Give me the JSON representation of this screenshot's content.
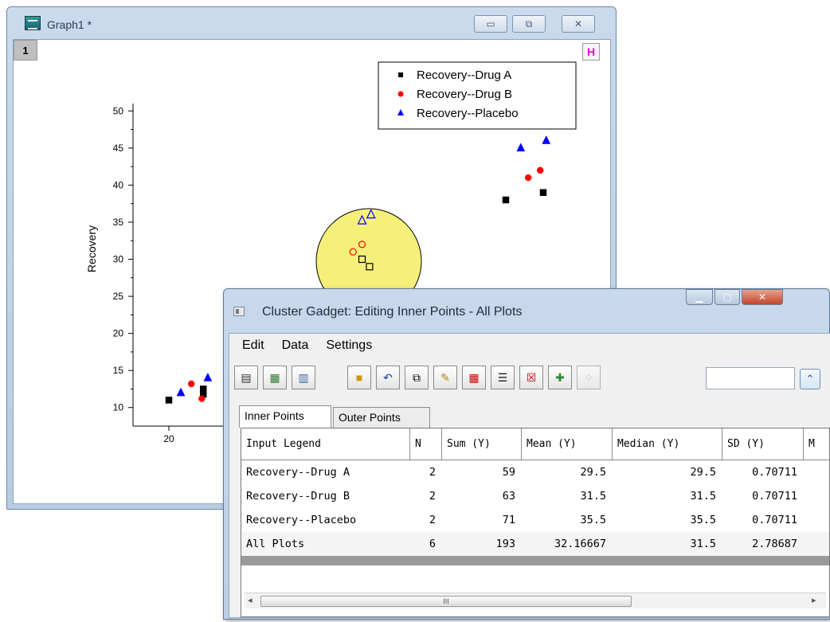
{
  "graph_window": {
    "title": "Graph1 *",
    "layer_label": "1",
    "h_button_label": "H",
    "minimize_glyph": "▭",
    "restore_glyph": "⧉",
    "close_glyph": "✕"
  },
  "chart_data": {
    "type": "scatter",
    "ylabel": "Recovery",
    "xlabel": "",
    "y_ticks": [
      "10",
      "15",
      "20",
      "25",
      "30",
      "35",
      "40",
      "45",
      "50"
    ],
    "x_ticks": [
      "20"
    ],
    "ylim": [
      7.5,
      51
    ],
    "legend_position": "top-right",
    "series": [
      {
        "name": "Recovery--Drug A",
        "color": "#000000",
        "marker": "square",
        "points": [
          [
            20,
            11
          ],
          [
            22.3,
            11.8
          ],
          [
            22.3,
            12.5
          ],
          [
            42.5,
            38
          ],
          [
            45,
            39
          ]
        ]
      },
      {
        "name": "Recovery--Drug B",
        "color": "#ff0000",
        "marker": "circle",
        "points": [
          [
            21.5,
            13.2
          ],
          [
            22.2,
            11.2
          ],
          [
            44,
            41
          ],
          [
            44.8,
            42
          ]
        ]
      },
      {
        "name": "Recovery--Placebo",
        "color": "#0000ff",
        "marker": "triangle",
        "points": [
          [
            20.8,
            12
          ],
          [
            22.6,
            14
          ],
          [
            43.5,
            45
          ],
          [
            45.2,
            46
          ]
        ]
      }
    ],
    "selected_points": {
      "Recovery--Drug A": [
        [
          32.9,
          30
        ],
        [
          33.4,
          29
        ]
      ],
      "Recovery--Drug B": [
        [
          32.3,
          31
        ],
        [
          32.9,
          32
        ]
      ],
      "Recovery--Placebo": [
        [
          32.9,
          35.2
        ],
        [
          33.5,
          36
        ]
      ]
    }
  },
  "cluster_gadget": {
    "title": "Cluster Gadget: Editing Inner Points - All Plots",
    "menu": [
      "Edit",
      "Data",
      "Settings"
    ],
    "tabs": [
      "Inner Points",
      "Outer Points"
    ],
    "collapse_glyph": "⌃",
    "columns": [
      "Input Legend",
      "N",
      "Sum (Y)",
      "Mean (Y)",
      "Median (Y)",
      "SD (Y)",
      "M"
    ],
    "rows": [
      [
        "Recovery--Drug A",
        "2",
        "59",
        "29.5",
        "29.5",
        "0.70711"
      ],
      [
        "Recovery--Drug B",
        "2",
        "63",
        "31.5",
        "31.5",
        "0.70711"
      ],
      [
        "Recovery--Placebo",
        "2",
        "71",
        "35.5",
        "35.5",
        "0.70711"
      ],
      [
        "All Plots",
        "6",
        "193",
        "32.16667",
        "31.5",
        "2.78687"
      ]
    ],
    "scroll_thumb_label": "III"
  }
}
